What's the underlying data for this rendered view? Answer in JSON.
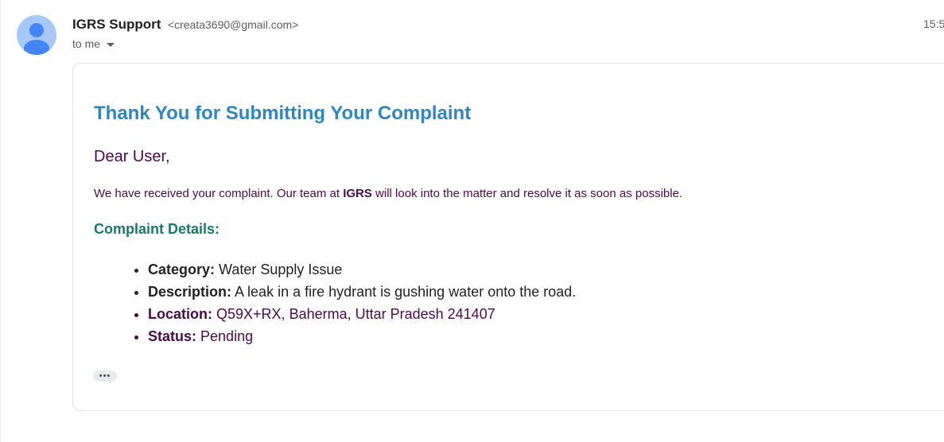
{
  "email": {
    "sender_name": "IGRS Support",
    "sender_email": "<creata3690@gmail.com>",
    "time": "15:5",
    "to": "to me",
    "title": "Thank You for Submitting Your Complaint",
    "greeting": "Dear User,",
    "message_before": "We have received your complaint. Our team at ",
    "message_org": "IGRS",
    "message_after": " will look into the matter and resolve it as soon as possible.",
    "details_heading": "Complaint Details:",
    "details": [
      {
        "label": "Category:",
        "value": "Water Supply Issue"
      },
      {
        "label": "Description:",
        "value": "A leak in a fire hydrant is gushing water onto the road."
      },
      {
        "label": "Location:",
        "value": "Q59X+RX, Baherma, Uttar Pradesh 241407"
      },
      {
        "label": "Status:",
        "value": "Pending"
      }
    ],
    "more_label": "•••"
  },
  "icons": {
    "avatar": "person-avatar-icon",
    "caret": "caret-down-icon",
    "more": "show-trimmed-content-icon"
  },
  "colors": {
    "title": "#2e86c1",
    "body_text": "#4a0a4a",
    "details_heading": "#1a7a5e",
    "avatar_bg": "#a8c7fa",
    "avatar_fg": "#4285f4"
  }
}
